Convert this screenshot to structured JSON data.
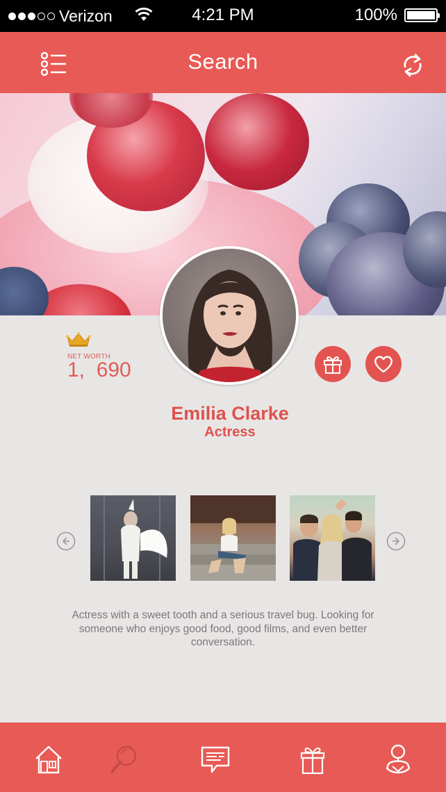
{
  "status_bar": {
    "carrier": "Verizon",
    "time": "4:21 PM",
    "battery": "100%",
    "signal_bars_filled": 3,
    "signal_bars_total": 5
  },
  "nav": {
    "title": "Search",
    "left_icon": "list-menu-icon",
    "right_icon": "refresh-icon"
  },
  "profile": {
    "net_worth_label": "NET WORTH",
    "net_worth_value": "1,  690",
    "name": "Emilia Clarke",
    "role": "Actress",
    "bio": "Actress with a sweet tooth and a serious travel bug. Looking for someone who enjoys good food, good films, and even better conversation."
  },
  "gallery": {
    "photo_count": 3
  },
  "tab_bar": {
    "tabs": [
      "home-icon",
      "search-icon",
      "messages-icon",
      "gift-icon",
      "profile-icon"
    ]
  },
  "colors": {
    "accent": "#e85a55",
    "background": "#e8e6e5",
    "text_secondary": "#7a7878"
  }
}
